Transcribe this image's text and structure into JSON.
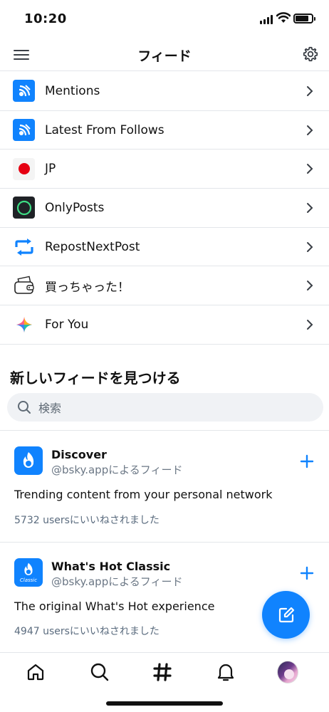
{
  "status_bar": {
    "time": "10:20"
  },
  "header": {
    "title": "フィード"
  },
  "feeds": [
    {
      "label": "Mentions",
      "icon": "feed-broadcast-icon"
    },
    {
      "label": "Latest From Follows",
      "icon": "feed-broadcast-icon"
    },
    {
      "label": "JP",
      "icon": "japan-flag-icon"
    },
    {
      "label": "OnlyPosts",
      "icon": "ring-icon"
    },
    {
      "label": "RepostNextPost",
      "icon": "repost-icon"
    },
    {
      "label": "買っちゃった！",
      "icon": "wallet-icon"
    },
    {
      "label": "For You",
      "icon": "sparkle-icon"
    }
  ],
  "discover": {
    "title": "新しいフィードを見つける",
    "search_placeholder": "検索",
    "cards": [
      {
        "name": "Discover",
        "by": "@bsky.appによるフィード",
        "description": "Trending content from your personal network",
        "likes": "5732 usersにいいねされました",
        "icon": "flame-icon"
      },
      {
        "name": "What's Hot Classic",
        "by": "@bsky.appによるフィード",
        "description": "The original What's Hot experience",
        "likes": "4947 usersにいいねされました",
        "icon": "flame-classic-icon",
        "icon_caption": "Classic"
      }
    ]
  },
  "colors": {
    "accent": "#1083fe",
    "separator": "#e3e6ea",
    "muted": "#6b7785"
  }
}
